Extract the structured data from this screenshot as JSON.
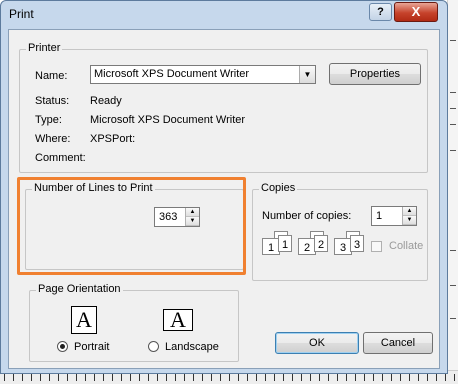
{
  "window": {
    "title": "Print",
    "help_label": "?",
    "close_label": "X"
  },
  "printer": {
    "group_label": "Printer",
    "name_label": "Name:",
    "name_value": "Microsoft XPS Document Writer",
    "properties_label": "Properties",
    "status_label": "Status:",
    "status_value": "Ready",
    "type_label": "Type:",
    "type_value": "Microsoft XPS Document Writer",
    "where_label": "Where:",
    "where_value": "XPSPort:",
    "comment_label": "Comment:"
  },
  "lines": {
    "group_label": "Number of Lines to Print",
    "value": "363"
  },
  "copies": {
    "group_label": "Copies",
    "count_label": "Number of copies:",
    "count_value": "1",
    "collate_label": "Collate",
    "collate_checked": false,
    "pages": [
      "1",
      "1",
      "2",
      "2",
      "3",
      "3"
    ]
  },
  "orientation": {
    "group_label": "Page Orientation",
    "portrait_label": "Portrait",
    "landscape_label": "Landscape",
    "selected": "Portrait",
    "icon_glyph": "A"
  },
  "buttons": {
    "ok_label": "OK",
    "cancel_label": "Cancel"
  },
  "colors": {
    "highlight": "#f08030",
    "title_bar": "#c6d8ec",
    "close": "#c6432c"
  }
}
